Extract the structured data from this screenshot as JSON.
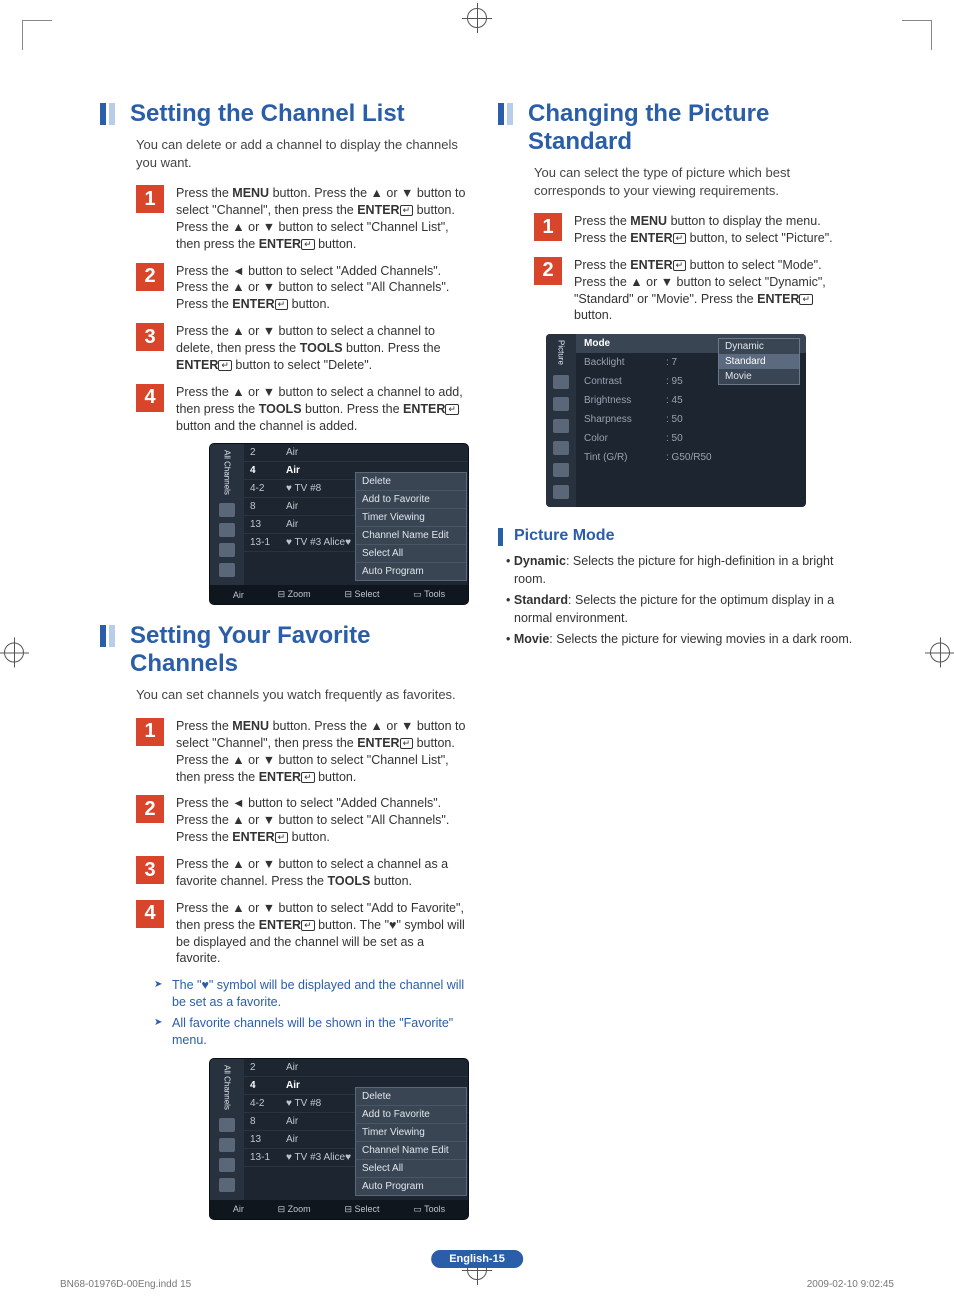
{
  "left": {
    "s1": {
      "title": "Setting the Channel List",
      "intro": "You can delete or add a channel to display the channels you want.",
      "step1": "Press the MENU button. Press the ▲ or ▼ button to select \"Channel\", then press the ENTER button. Press the ▲ or ▼ button to select \"Channel List\", then press the ENTER button.",
      "step2": "Press the ◄ button to select \"Added Channels\". Press the ▲ or ▼ button to select \"All Channels\". Press the ENTER button.",
      "step3": "Press the ▲ or ▼ button to select a channel to delete, then press the TOOLS button. Press the ENTER button to select \"Delete\".",
      "step4": "Press the ▲ or ▼ button to select a channel to add, then press the TOOLS button. Press the ENTER button and the channel is added."
    },
    "s2": {
      "title": "Setting Your Favorite Channels",
      "intro": "You can set channels you watch frequently as favorites.",
      "step1": "Press the MENU button. Press the ▲ or ▼ button to select \"Channel\", then press the ENTER button. Press the ▲ or ▼ button to select \"Channel List\", then press the ENTER button.",
      "step2": "Press the ◄ button to select \"Added Channels\". Press the ▲ or ▼ button to select \"All Channels\". Press the ENTER button.",
      "step3": "Press the ▲ or ▼ button to select a channel as a favorite channel. Press the TOOLS button.",
      "step4": "Press the ▲ or ▼ button to select \"Add to Favorite\", then press the ENTER button. The \"♥\" symbol will be displayed and the channel will be set as a favorite.",
      "note1": "The \"♥\" symbol will be displayed and the channel will be set as a favorite.",
      "note2": "All favorite channels will be shown in the \"Favorite\" menu."
    },
    "osd": {
      "side_label": "All Channels",
      "rows": [
        {
          "c1": "2",
          "c2": "Air"
        },
        {
          "c1": "4",
          "c2": "Air",
          "hl": true
        },
        {
          "c1": "4-2",
          "c2": "♥ TV #8"
        },
        {
          "c1": "8",
          "c2": "Air"
        },
        {
          "c1": "13",
          "c2": "Air"
        },
        {
          "c1": "13-1",
          "c2": "♥ TV #3  Alice♥"
        }
      ],
      "popup": [
        "Delete",
        "Add to Favorite",
        "Timer Viewing",
        "Channel Name Edit",
        "Select All",
        "Auto Program"
      ],
      "foot": {
        "a": "Air",
        "b": "Zoom",
        "c": "Select",
        "d": "Tools"
      }
    }
  },
  "right": {
    "s1": {
      "title": "Changing the Picture Standard",
      "intro": "You can select the type of picture which best corresponds to your viewing requirements.",
      "step1": "Press the MENU button to display the menu. Press the ENTER button, to select \"Picture\".",
      "step2": "Press the ENTER button to select \"Mode\". Press the ▲ or ▼ button to select \"Dynamic\", \"Standard\" or \"Movie\". Press the ENTER button."
    },
    "osd": {
      "side_label": "Picture",
      "rows": [
        {
          "lab": "Mode",
          "val": "",
          "hd": true
        },
        {
          "lab": "Backlight",
          "val": ": 7"
        },
        {
          "lab": "Contrast",
          "val": ": 95"
        },
        {
          "lab": "Brightness",
          "val": ": 45"
        },
        {
          "lab": "Sharpness",
          "val": ": 50"
        },
        {
          "lab": "Color",
          "val": ": 50"
        },
        {
          "lab": "Tint (G/R)",
          "val": ": G50/R50"
        }
      ],
      "popup": [
        "Dynamic",
        "Standard",
        "Movie"
      ]
    },
    "sub": {
      "title": "Picture Mode",
      "b1": "Dynamic: Selects the picture for high-definition in a bright room.",
      "b2": "Standard: Selects the picture for the optimum display in a normal environment.",
      "b3": "Movie: Selects the picture for viewing movies in a dark room."
    }
  },
  "page_badge": "English-15",
  "footer": {
    "file": "BN68-01976D-00Eng.indd   15",
    "date": "2009-02-10     9:02:45"
  },
  "nums": {
    "n1": "1",
    "n2": "2",
    "n3": "3",
    "n4": "4"
  }
}
